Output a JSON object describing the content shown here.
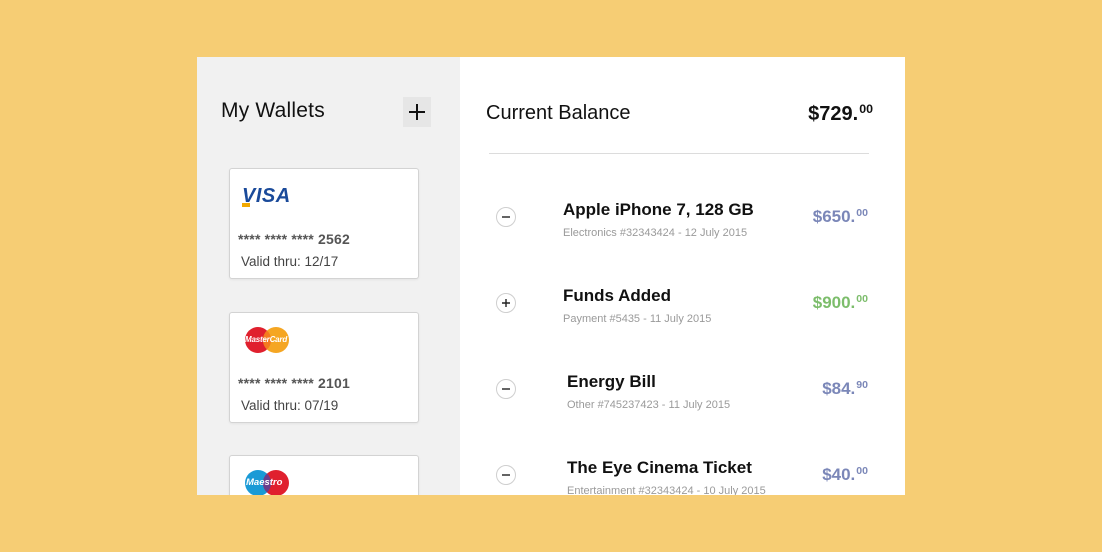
{
  "sidebar": {
    "title": "My Wallets",
    "add_label": "+",
    "cards": [
      {
        "brand": "VISA",
        "number": "**** **** **** 2562",
        "valid": "Valid thru: 12/17"
      },
      {
        "brand": "MasterCard",
        "number": "**** **** **** 2101",
        "valid": "Valid thru: 07/19"
      },
      {
        "brand": "Maestro",
        "number": "",
        "valid": ""
      }
    ]
  },
  "balance": {
    "label": "Current Balance",
    "amount_main": "$729.",
    "amount_cents": "00"
  },
  "transactions": [
    {
      "title": "Apple iPhone 7, 128 GB",
      "meta": "Electronics #32343424 - 12 July 2015",
      "type": "minus",
      "amount_main": "$650.",
      "amount_cents": "00",
      "color": "#7b87b8"
    },
    {
      "title": "Funds Added",
      "meta": "Payment #5435 - 11 July 2015",
      "type": "plus",
      "amount_main": "$900.",
      "amount_cents": "00",
      "color": "#7cbd6b"
    },
    {
      "title": "Energy Bill",
      "meta": "Other #745237423 - 11 July 2015",
      "type": "minus",
      "amount_main": "$84.",
      "amount_cents": "90",
      "color": "#7b87b8"
    },
    {
      "title": "The Eye Cinema Ticket",
      "meta": "Entertainment #32343424 - 10 July 2015",
      "type": "minus",
      "amount_main": "$40.",
      "amount_cents": "00",
      "color": "#7b87b8"
    }
  ],
  "colors": {
    "background": "#f6cd74",
    "expense": "#7b87b8",
    "income": "#7cbd6b",
    "visa_blue": "#1a4a9a"
  },
  "icons": {
    "add": "plus-icon",
    "expense_toggle": "minus-icon",
    "income_toggle": "plus-icon"
  }
}
